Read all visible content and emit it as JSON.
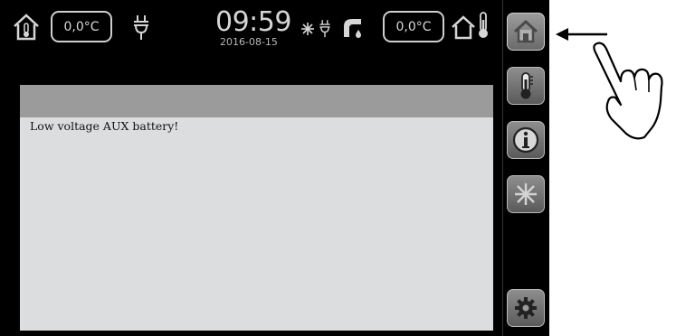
{
  "status_bar": {
    "indoor_temp": "0,0°C",
    "time": "09:59",
    "date": "2016-08-15",
    "outdoor_temp": "0,0°C",
    "icons": [
      "home-thermometer-icon",
      "plug-icon",
      "snowflake-icon",
      "plug-icon",
      "faucet-icon",
      "home-outline-icon",
      "thermometer-icon"
    ]
  },
  "message_panel": {
    "text": "Low voltage AUX battery!"
  },
  "side_menu": {
    "buttons": [
      {
        "name": "home",
        "icon": "home-icon",
        "active": true
      },
      {
        "name": "temperature",
        "icon": "thermometer-icon"
      },
      {
        "name": "info",
        "icon": "info-icon"
      },
      {
        "name": "cooling",
        "icon": "snowflake-icon"
      },
      {
        "name": "settings",
        "icon": "gear-icon"
      }
    ]
  },
  "annotation": {
    "icons": [
      "arrow-left-icon",
      "pointing-hand-icon"
    ]
  },
  "colors": {
    "background": "#000000",
    "panel": "#dcdddf",
    "panel_header": "#9b9b9b",
    "button": "#7a7a7a"
  }
}
